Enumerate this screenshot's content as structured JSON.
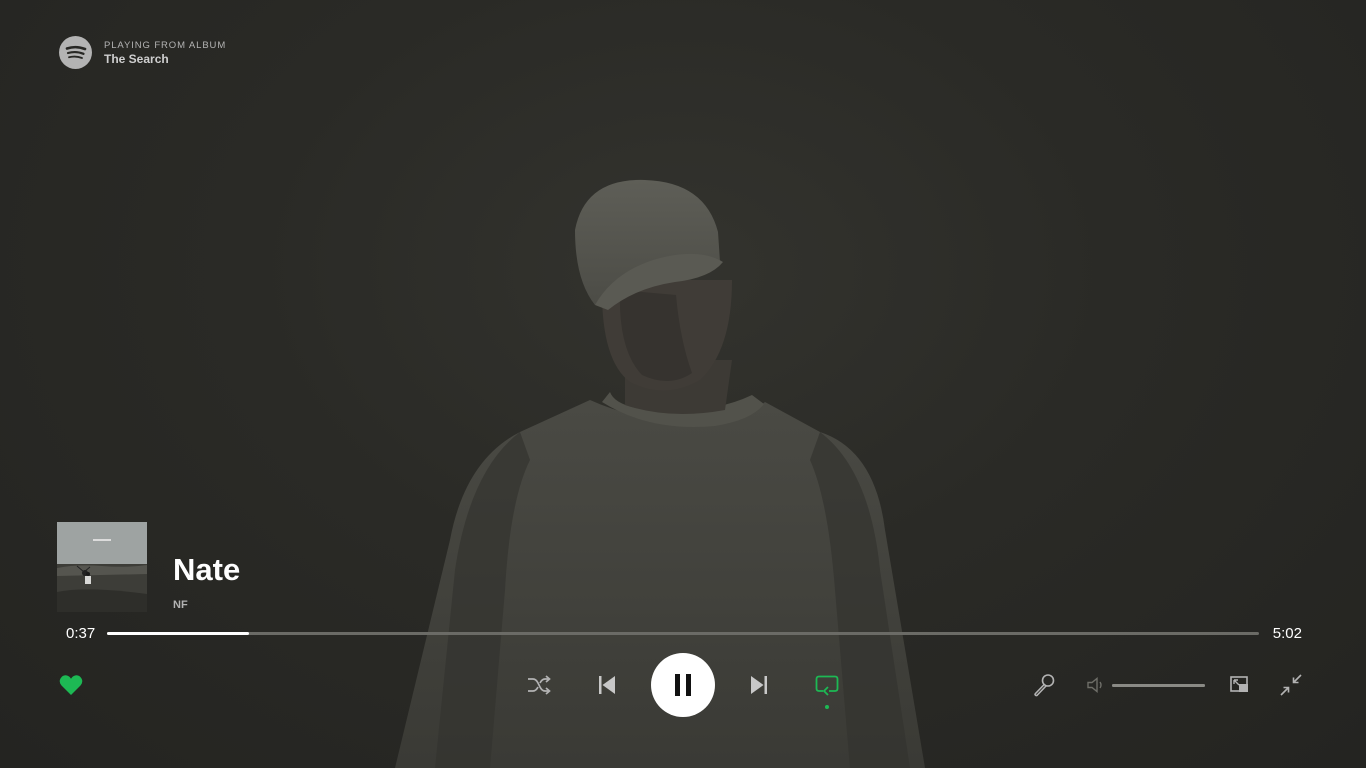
{
  "context": {
    "label": "PLAYING FROM ALBUM",
    "name": "The Search"
  },
  "track": {
    "title": "Nate",
    "artist": "NF"
  },
  "playback": {
    "elapsed": "0:37",
    "duration": "5:02",
    "progress_fraction": 0.123,
    "volume_fraction": 1.0,
    "is_playing": true,
    "liked": true,
    "repeat_enabled": true
  },
  "icons": {
    "logo": "spotify-logo-icon",
    "like": "heart-icon",
    "shuffle": "shuffle-icon",
    "previous": "skip-back-icon",
    "pause": "pause-icon",
    "next": "skip-forward-icon",
    "repeat": "repeat-icon",
    "lyrics": "microphone-icon",
    "volume": "speaker-icon",
    "miniplayer": "picture-in-picture-icon",
    "exit_fullscreen": "minimize-icon"
  },
  "colors": {
    "accent": "#1db954",
    "background": "#272724",
    "text_primary": "#ffffff",
    "text_secondary": "#b3b3b3"
  }
}
